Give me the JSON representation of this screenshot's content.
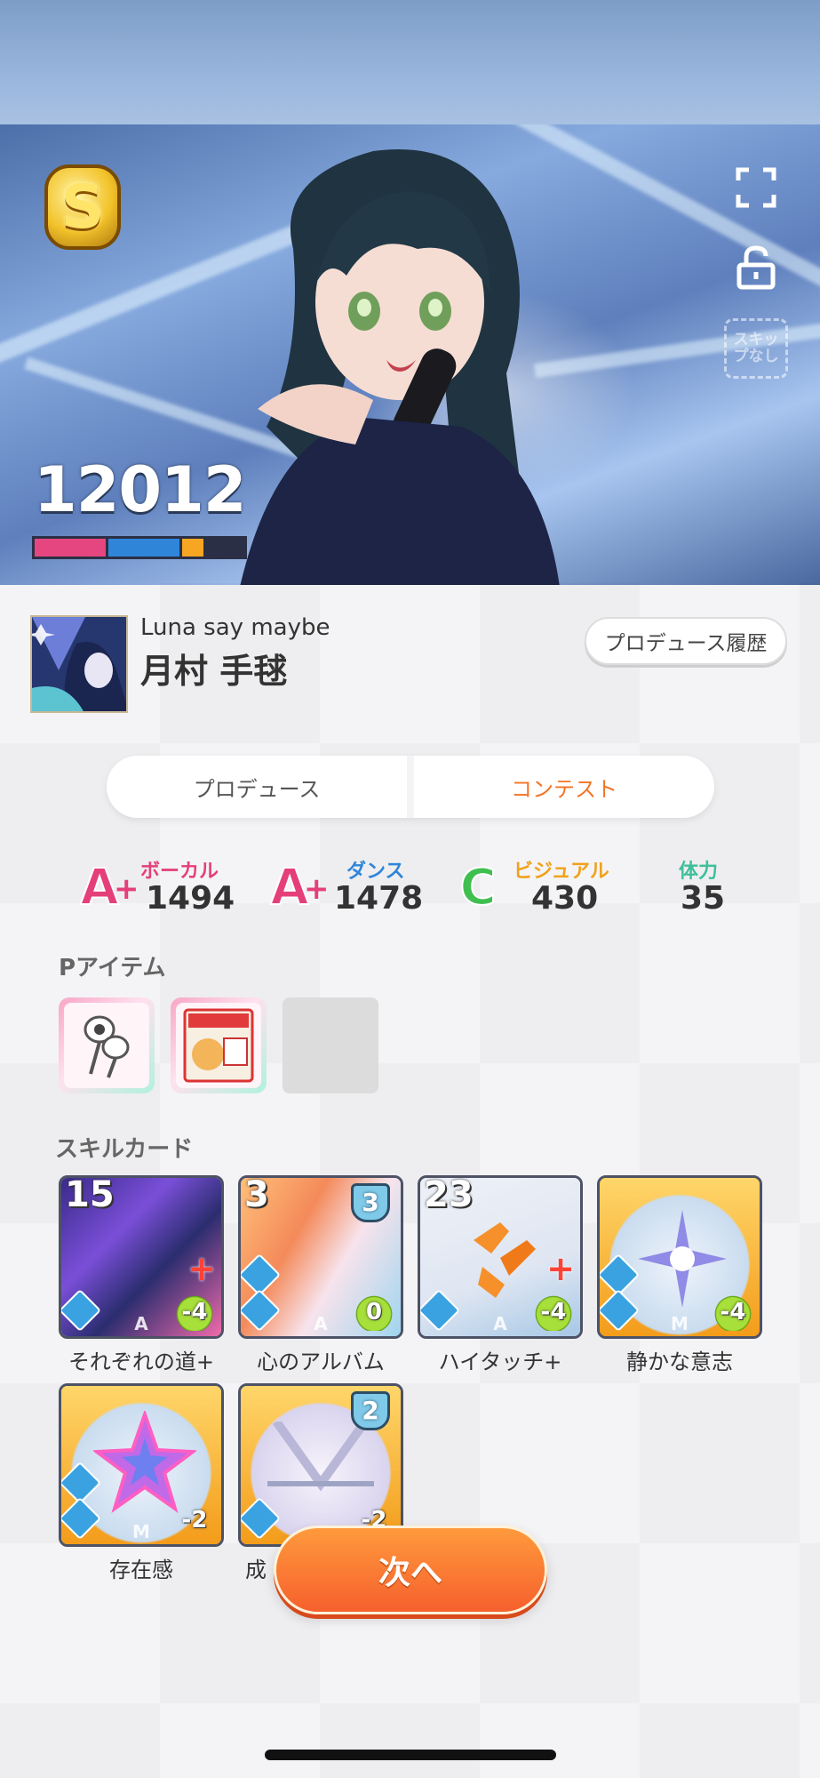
{
  "hero": {
    "rank": "S",
    "score": "12012",
    "skip_label": "スキップなし",
    "score_bar": [
      {
        "color": "#e5467f",
        "fraction": 0.34
      },
      {
        "color": "#2f86d9",
        "fraction": 0.34
      },
      {
        "color": "#f6a623",
        "fraction": 0.1
      }
    ]
  },
  "card": {
    "title": "Luna say maybe",
    "name": "月村 手毬",
    "history_button": "プロデュース履歴"
  },
  "tabs": {
    "produce": "プロデュース",
    "contest": "コンテスト",
    "active": "contest"
  },
  "stats": [
    {
      "grade": "A",
      "plus": "+",
      "label": "ボーカル",
      "value": "1494",
      "color": "#e53f7a"
    },
    {
      "grade": "A",
      "plus": "+",
      "label": "ダンス",
      "value": "1478",
      "color": "#2f86d9"
    },
    {
      "grade": "C",
      "plus": "",
      "label": "ビジュアル",
      "value": "430",
      "color": "#f0a21c"
    },
    {
      "grade": "",
      "plus": "",
      "label": "体力",
      "value": "35",
      "color": "#3fbf9a"
    }
  ],
  "p_items": {
    "heading": "Pアイテム"
  },
  "skill_cards": {
    "heading": "スキルカード",
    "cards": [
      {
        "name": "それぞれの道+",
        "level": "15",
        "cost": "-4",
        "type": "A",
        "shield": ""
      },
      {
        "name": "心のアルバム",
        "level": "3",
        "cost": "0",
        "type": "A",
        "shield": "3"
      },
      {
        "name": "ハイタッチ+",
        "level": "23",
        "cost": "-4",
        "type": "A",
        "shield": ""
      },
      {
        "name": "静かな意志",
        "level": "",
        "cost": "-4",
        "type": "M",
        "shield": ""
      },
      {
        "name": "存在感",
        "level": "",
        "cost": "-2",
        "type": "M",
        "shield": ""
      },
      {
        "name": "成",
        "level": "",
        "cost": "-2",
        "type": "",
        "shield": "2"
      }
    ]
  },
  "next_button": "次へ",
  "colors": {
    "accent": "#f37426",
    "next_button": "#f6602d"
  }
}
